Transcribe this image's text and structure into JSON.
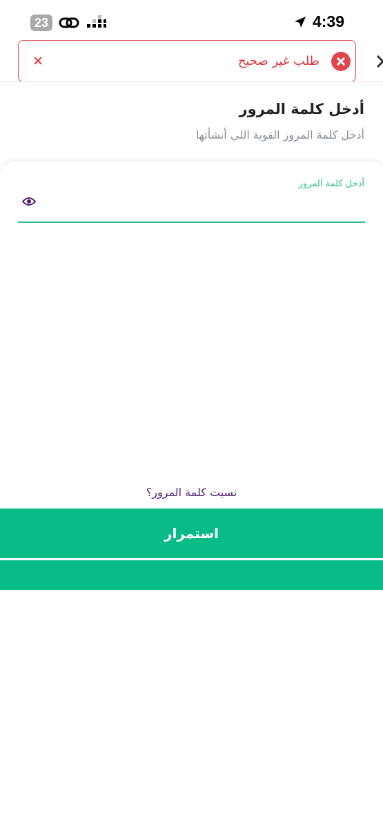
{
  "status_bar": {
    "time": "4:39",
    "notification_count": "23",
    "icons": [
      "link-icon",
      "signal-icon",
      "location-arrow-icon"
    ]
  },
  "toast": {
    "message": "طلب غير صحيح",
    "icon": "error-x-icon",
    "close_icon": "close-icon",
    "accent_color": "#e0474c"
  },
  "header": {
    "back_icon": "chevron-icon"
  },
  "page": {
    "title": "أدخل كلمة المرور",
    "subtitle": "أدخل كلمة المرور القوية اللي أنشأتها"
  },
  "password_field": {
    "label": "أدخل كلمة المرور",
    "value": "",
    "icon": "eye-icon",
    "accent_color": "#34c08d"
  },
  "actions": {
    "forgot_password": "نسيت كلمة المرور؟",
    "continue_label": "استمرار",
    "button_color": "#07bb86"
  }
}
